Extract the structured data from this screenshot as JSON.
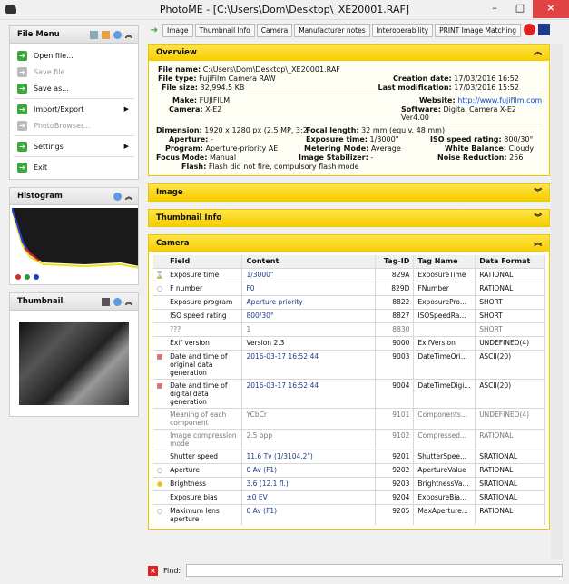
{
  "window": {
    "title": "PhotoME - [C:\\Users\\Dom\\Desktop\\_XE20001.RAF]",
    "min": "–",
    "max": "□",
    "close": "×"
  },
  "file_menu": {
    "title": "File Menu",
    "items": [
      {
        "label": "Open file...",
        "enabled": true
      },
      {
        "label": "Save file",
        "enabled": false
      },
      {
        "label": "Save as...",
        "enabled": true
      },
      {
        "label": "Import/Export",
        "enabled": true,
        "submenu": true
      },
      {
        "label": "PhotoBrowser...",
        "enabled": false
      },
      {
        "label": "Settings",
        "enabled": true,
        "submenu": true
      },
      {
        "label": "Exit",
        "enabled": true
      }
    ]
  },
  "histogram": {
    "title": "Histogram",
    "channels": [
      "#d03020",
      "#20a030",
      "#2040c0"
    ]
  },
  "thumbnail": {
    "title": "Thumbnail"
  },
  "tabs": [
    "Image",
    "Thumbnail Info",
    "Camera",
    "Manufacturer notes",
    "Interoperability",
    "PRINT Image Matching"
  ],
  "overview": {
    "title": "Overview",
    "file_name": {
      "k": "File name:",
      "v": "C:\\Users\\Dom\\Desktop\\_XE20001.RAF"
    },
    "file_type": {
      "k": "File type:",
      "v": "FujiFilm Camera RAW"
    },
    "creation_date": {
      "k": "Creation date:",
      "v": "17/03/2016 16:52"
    },
    "file_size": {
      "k": "File size:",
      "v": "32,994.5 KB"
    },
    "last_mod": {
      "k": "Last modification:",
      "v": "17/03/2016 15:52"
    },
    "make": {
      "k": "Make:",
      "v": "FUJIFILM"
    },
    "website": {
      "k": "Website:",
      "v": "http://www.fujifilm.com"
    },
    "camera": {
      "k": "Camera:",
      "v": "X-E2"
    },
    "software": {
      "k": "Software:",
      "v": "Digital Camera X-E2 Ver4.00"
    },
    "dimension": {
      "k": "Dimension:",
      "v": "1920 x 1280 px (2.5 MP, 3:2)"
    },
    "focal": {
      "k": "Focal length:",
      "v": "32 mm (equiv. 48 mm)"
    },
    "aperture": {
      "k": "Aperture:",
      "v": "-"
    },
    "exposure": {
      "k": "Exposure time:",
      "v": "1/3000\""
    },
    "iso": {
      "k": "ISO speed rating:",
      "v": "800/30°"
    },
    "program": {
      "k": "Program:",
      "v": "Aperture-priority AE"
    },
    "metering": {
      "k": "Metering Mode:",
      "v": "Average"
    },
    "wb": {
      "k": "White Balance:",
      "v": "Cloudy"
    },
    "focus": {
      "k": "Focus Mode:",
      "v": "Manual"
    },
    "stabilizer": {
      "k": "Image Stabilizer:",
      "v": "-"
    },
    "noise": {
      "k": "Noise Reduction:",
      "v": "256"
    },
    "flash": {
      "k": "Flash:",
      "v": "Flash did not fire, compulsory flash mode"
    }
  },
  "sections": {
    "image": "Image",
    "thumbnail_info": "Thumbnail Info",
    "camera": "Camera"
  },
  "camera_table": {
    "headers": [
      "Field",
      "Content",
      "Tag-ID",
      "Tag Name",
      "Data Format"
    ],
    "rows": [
      {
        "icon": "hourglass",
        "field": "Exposure time",
        "content": "1/3000\"",
        "id": "829A",
        "name": "ExposureTime",
        "format": "RATIONAL",
        "blue": true
      },
      {
        "icon": "aperture",
        "field": "F number",
        "content": "F0",
        "id": "829D",
        "name": "FNumber",
        "format": "RATIONAL",
        "blue": true
      },
      {
        "icon": "",
        "field": "Exposure program",
        "content": "Aperture priority",
        "id": "8822",
        "name": "ExposurePro...",
        "format": "SHORT",
        "blue": true
      },
      {
        "icon": "",
        "field": "ISO speed rating",
        "content": "800/30°",
        "id": "8827",
        "name": "ISOSpeedRa...",
        "format": "SHORT",
        "blue": true
      },
      {
        "icon": "",
        "field": "???",
        "content": "1",
        "id": "8830",
        "name": "",
        "format": "SHORT",
        "dim": true
      },
      {
        "icon": "",
        "field": "Exif version",
        "content": "Version 2.3",
        "id": "9000",
        "name": "ExifVersion",
        "format": "UNDEFINED(4)"
      },
      {
        "icon": "calendar",
        "field": "Date and time of original data generation",
        "content": "2016-03-17 16:52:44",
        "id": "9003",
        "name": "DateTimeOri...",
        "format": "ASCII(20)",
        "blue": true
      },
      {
        "icon": "calendar",
        "field": "Date and time of digital data generation",
        "content": "2016-03-17 16:52:44",
        "id": "9004",
        "name": "DateTimeDigi...",
        "format": "ASCII(20)",
        "blue": true
      },
      {
        "icon": "",
        "field": "Meaning of each component",
        "content": "YCbCr",
        "id": "9101",
        "name": "Components...",
        "format": "UNDEFINED(4)",
        "dim": true
      },
      {
        "icon": "",
        "field": "Image compression mode",
        "content": "2.5 bpp",
        "id": "9102",
        "name": "Compressed...",
        "format": "RATIONAL",
        "dim": true
      },
      {
        "icon": "",
        "field": "Shutter speed",
        "content": "11.6 Tv (1/3104.2\")",
        "id": "9201",
        "name": "ShutterSpee...",
        "format": "SRATIONAL",
        "blue": true
      },
      {
        "icon": "aperture",
        "field": "Aperture",
        "content": "0 Av (F1)",
        "id": "9202",
        "name": "ApertureValue",
        "format": "RATIONAL",
        "blue": true
      },
      {
        "icon": "sun",
        "field": "Brightness",
        "content": "3.6 (12.1 fl.)",
        "id": "9203",
        "name": "BrightnessVa...",
        "format": "SRATIONAL",
        "blue": true
      },
      {
        "icon": "",
        "field": "Exposure bias",
        "content": "±0 EV",
        "id": "9204",
        "name": "ExposureBia...",
        "format": "SRATIONAL",
        "blue": true
      },
      {
        "icon": "aperture",
        "field": "Maximum lens aperture",
        "content": "0 Av (F1)",
        "id": "9205",
        "name": "MaxAperture...",
        "format": "RATIONAL",
        "blue": true
      }
    ]
  },
  "find": {
    "label": "Find:",
    "value": ""
  }
}
